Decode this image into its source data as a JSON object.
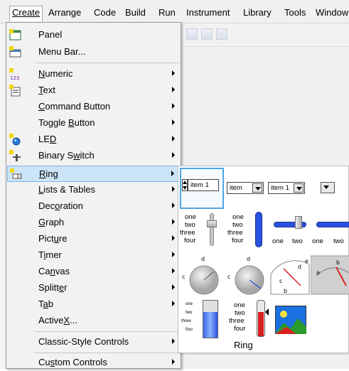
{
  "menubar": {
    "items": [
      "Create",
      "Arrange",
      "Code",
      "Build",
      "Run",
      "Instrument",
      "Library",
      "Tools",
      "Window"
    ],
    "active": "Create"
  },
  "menu": {
    "items": [
      {
        "label": "Panel",
        "icon": "panel-icon",
        "submenu": false
      },
      {
        "label": "Menu Bar...",
        "icon": "menu-bar-icon",
        "submenu": false
      },
      {
        "label": "Numeric",
        "icon": "numeric-icon",
        "submenu": true
      },
      {
        "label": "Text",
        "icon": "text-icon",
        "submenu": true
      },
      {
        "label": "Command Button",
        "icon": "",
        "submenu": true
      },
      {
        "label": "Toggle Button",
        "icon": "",
        "submenu": true
      },
      {
        "label": "LED",
        "icon": "led-icon",
        "submenu": true
      },
      {
        "label": "Binary Switch",
        "icon": "binary-switch-icon",
        "submenu": true
      },
      {
        "label": "Ring",
        "icon": "ring-icon",
        "submenu": true,
        "highlighted": true
      },
      {
        "label": "Lists & Tables",
        "icon": "",
        "submenu": true
      },
      {
        "label": "Decoration",
        "icon": "",
        "submenu": true
      },
      {
        "label": "Graph",
        "icon": "",
        "submenu": true
      },
      {
        "label": "Picture",
        "icon": "",
        "submenu": true
      },
      {
        "label": "Timer",
        "icon": "",
        "submenu": true
      },
      {
        "label": "Canvas",
        "icon": "",
        "submenu": true
      },
      {
        "label": "Splitter",
        "icon": "",
        "submenu": true
      },
      {
        "label": "Tab",
        "icon": "",
        "submenu": true
      },
      {
        "label": "ActiveX...",
        "icon": "",
        "submenu": false
      },
      {
        "label": "Classic-Style Controls",
        "icon": "",
        "submenu": true
      },
      {
        "label": "Custom Controls",
        "icon": "",
        "submenu": true
      }
    ]
  },
  "palette": {
    "title": "Ring",
    "ring_value": "item 1",
    "menu_ring_values": [
      "item",
      "item 1"
    ],
    "slide_labels": [
      "one",
      "two",
      "three",
      "four"
    ],
    "horizontal_labels": [
      "one",
      "two",
      "one",
      "two"
    ],
    "dial_labels": [
      "d",
      "c",
      "d",
      "c"
    ],
    "meter_labels": [
      "d",
      "e",
      "c",
      "b"
    ],
    "gauge_labels": [
      "b",
      "a"
    ]
  },
  "colors": {
    "highlight": "#cce4f7",
    "highlight_border": "#7eb4ea",
    "selection": "#4ea6e6",
    "slide_blue": "#2a52e0",
    "needle_red": "#d82020"
  }
}
